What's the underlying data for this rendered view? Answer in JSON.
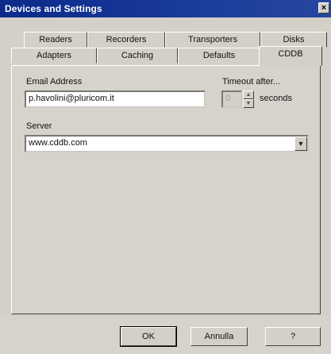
{
  "window": {
    "title": "Devices and Settings",
    "close_glyph": "×"
  },
  "tabs_row1": [
    "Readers",
    "Recorders",
    "Transporters",
    "Disks"
  ],
  "tabs_row2": [
    "Adapters",
    "Caching",
    "Defaults",
    "CDDB"
  ],
  "selected_tab": "CDDB",
  "form": {
    "email_label": "Email Address",
    "email_value": "p.havolini@pluricom.it",
    "timeout_label": "Timeout after...",
    "timeout_value": "0",
    "timeout_unit": "seconds",
    "server_label": "Server",
    "server_value": "www.cddb.com"
  },
  "buttons": {
    "ok": "OK",
    "cancel": "Annulla",
    "help": "?"
  }
}
